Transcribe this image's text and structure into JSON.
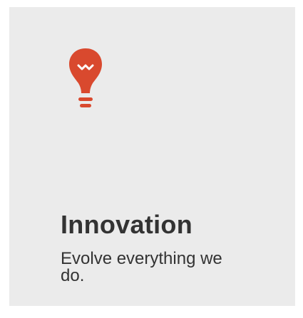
{
  "card": {
    "title": "Innovation",
    "subtitle": "Evolve everything we do.",
    "icon": "lightbulb-icon",
    "background": "#ebebeb",
    "accent_color": "#d9492e",
    "text_color": "#333333"
  }
}
